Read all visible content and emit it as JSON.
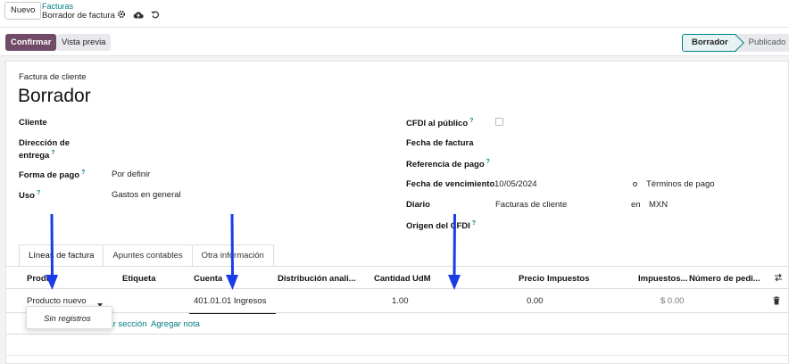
{
  "topbar": {
    "new_button": "Nuevo",
    "breadcrumb_parent": "Facturas",
    "breadcrumb_current": "Borrador de factura",
    "icons": [
      "gear-icon",
      "cloud-upload-icon",
      "undo-icon"
    ]
  },
  "actionbar": {
    "confirm_label": "Confirmar",
    "preview_label": "Vista previa",
    "status_steps": [
      "Borrador",
      "Publicado"
    ],
    "active_step": "Borrador"
  },
  "form": {
    "doc_type": "Factura de cliente",
    "title": "Borrador",
    "left_fields": {
      "cliente": {
        "label": "Cliente",
        "value": ""
      },
      "direccion": {
        "label_line1": "Dirección de",
        "label_line2": "entrega",
        "value": ""
      },
      "forma_pago": {
        "label": "Forma de pago",
        "value": "Por definir"
      },
      "uso": {
        "label": "Uso",
        "value": "Gastos en general"
      }
    },
    "right_fields": {
      "cfdi": {
        "label": "CFDI al público",
        "checked": false
      },
      "fecha_factura": {
        "label": "Fecha de factura",
        "value": ""
      },
      "referencia": {
        "label": "Referencia de pago",
        "value": ""
      },
      "vencimiento": {
        "label": "Fecha de vencimiento",
        "value": "10/05/2024",
        "alt_label": "Términos de pago"
      },
      "diario": {
        "label": "Diario",
        "value": "Facturas de cliente",
        "currency_prefix": "en",
        "currency": "MXN"
      },
      "origen": {
        "label": "Origen del CFDI"
      }
    }
  },
  "tabs": [
    "Líneas de factura",
    "Apuntes contables",
    "Otra información"
  ],
  "table": {
    "headers": {
      "producto": "Produ",
      "etiqueta": "Etiqueta",
      "cuenta": "Cuenta",
      "distribucion": "Distribución anali...",
      "cantidad": "Cantidad",
      "udm": "UdM",
      "precio": "Precio",
      "impuestos": "Impuestos",
      "impuestos2": "Impuestos...",
      "numero_pedido": "Número de pedi..."
    },
    "row": {
      "producto": "Producto nuevo",
      "cuenta": "401.01.01 Ingresos",
      "cantidad": "1.00",
      "precio": "0.00",
      "subtotal": "$ 0.00"
    },
    "add_section": "gar sección",
    "add_note": "Agregar nota"
  },
  "dropdown": {
    "empty_text": "Sin registros"
  },
  "colors": {
    "brand": "#714b67",
    "accent": "#017e84",
    "arrow": "#1a3be8"
  }
}
